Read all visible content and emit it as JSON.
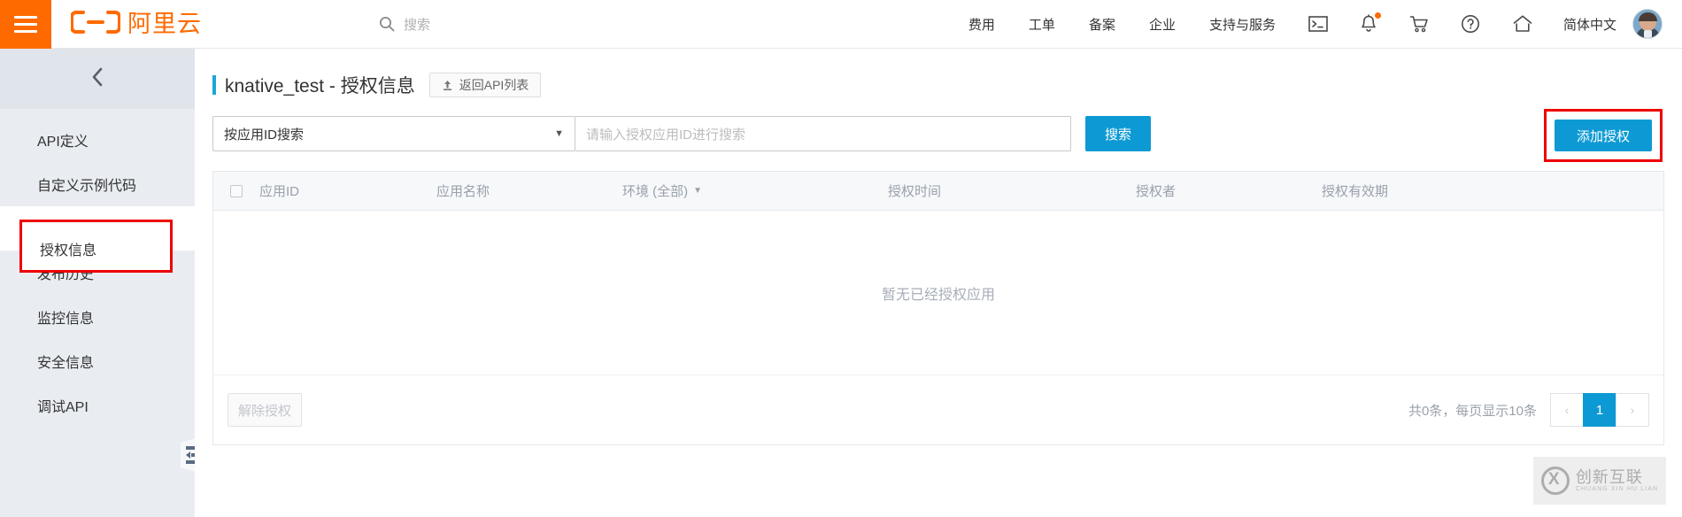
{
  "header": {
    "menu_icon": "hamburger-icon",
    "brand": "阿里云",
    "search": {
      "icon": "search-icon",
      "placeholder": "搜索"
    },
    "links": [
      "费用",
      "工单",
      "备案",
      "企业",
      "支持与服务"
    ],
    "icons": [
      "terminal-icon",
      "bell-icon",
      "cart-icon",
      "help-icon",
      "home-icon"
    ],
    "language": "简体中文",
    "avatar": "user-avatar"
  },
  "sidebar": {
    "collapse_icon": "chevron-left-icon",
    "items": [
      {
        "label": "API定义",
        "active": false
      },
      {
        "label": "自定义示例代码",
        "active": false
      },
      {
        "label": "授权信息",
        "active": true
      },
      {
        "label": "发布历史",
        "active": false
      },
      {
        "label": "监控信息",
        "active": false
      },
      {
        "label": "安全信息",
        "active": false
      },
      {
        "label": "调试API",
        "active": false
      }
    ],
    "handle_icon": "panel-collapse-icon"
  },
  "page": {
    "title": "knative_test - 授权信息",
    "back_button": {
      "label": "返回API列表",
      "icon": "upload-arrow-icon"
    }
  },
  "filter": {
    "select_value": "按应用ID搜索",
    "select_caret": "chevron-down-icon",
    "input_placeholder": "请输入授权应用ID进行搜索",
    "input_value": "",
    "search_button": "搜索",
    "add_button": "添加授权"
  },
  "table": {
    "columns": [
      "应用ID",
      "应用名称",
      "环境 (全部)",
      "授权时间",
      "授权者",
      "授权有效期"
    ],
    "env_caret": "caret-down-icon",
    "select_all": "select-all-checkbox",
    "rows": [],
    "empty_text": "暂无已经授权应用"
  },
  "footer": {
    "release_button": "解除授权",
    "pager_info": "共0条，每页显示10条",
    "prev": "‹",
    "pages": [
      "1"
    ],
    "current_page": "1",
    "next": "›"
  },
  "watermark": {
    "cn": "创新互联",
    "en": "CHUANG XIN HU LIAN"
  },
  "colors": {
    "brand_orange": "#ff6a00",
    "accent_blue": "#0d9ad4",
    "highlight_red": "#ee0000",
    "sidebar_bg": "#e9edf2"
  }
}
